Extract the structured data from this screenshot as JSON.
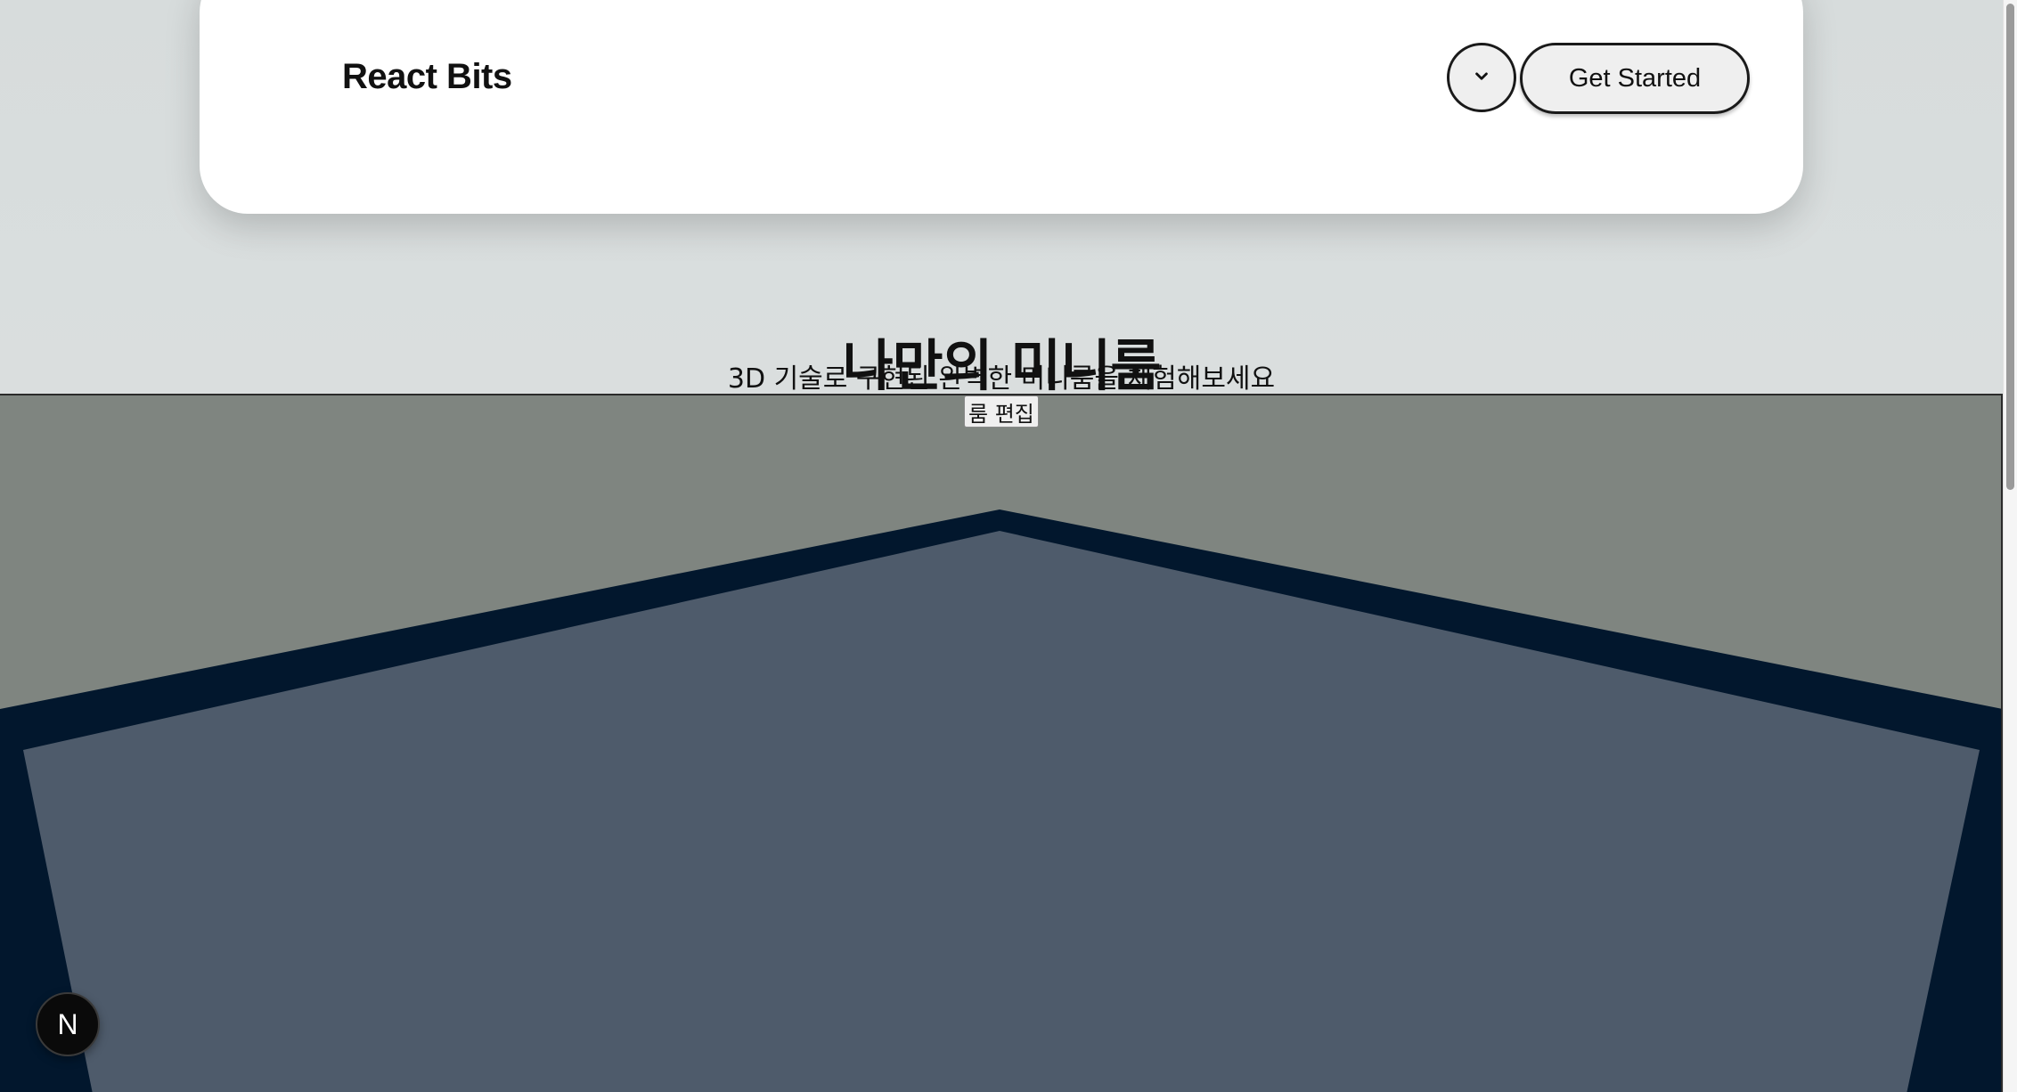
{
  "navbar": {
    "brand": "React Bits",
    "menu_icon": "chevron-down-icon",
    "cta_label": "Get Started"
  },
  "hero": {
    "title": "나만의 미니룸",
    "subtitle": "3D 기술로 구현된 완벽한 미니룸을 체험해보세요"
  },
  "scene": {
    "edit_button_label": "룸 편집",
    "colors": {
      "background": "#7f8580",
      "wall_outline": "#02172d",
      "wall_fill": "#4e5b6b"
    }
  },
  "dev_indicator": {
    "label": "N"
  }
}
